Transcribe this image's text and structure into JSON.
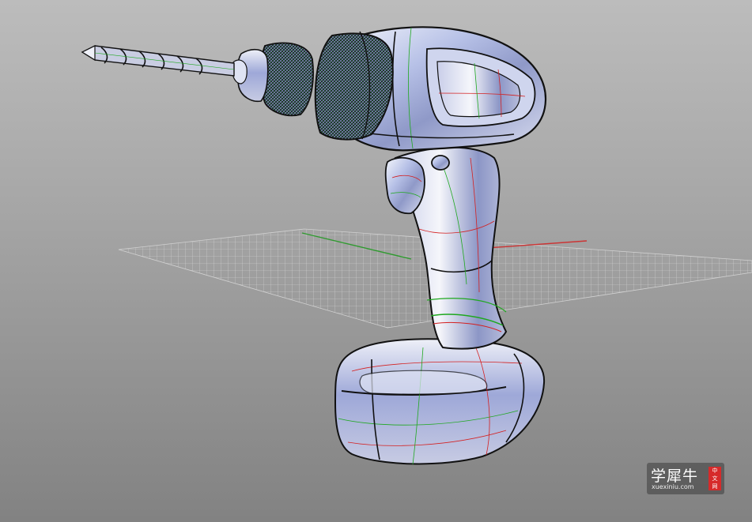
{
  "viewport": {
    "background_top": "#bcbcbc",
    "background_bottom": "#828282",
    "grid_color": "#d9d9d9",
    "x_axis_color": "#cc3333",
    "y_axis_color": "#2f9a2f"
  },
  "model": {
    "surface_color": "#a9b6e6",
    "isocurve_red": "#d42020",
    "isocurve_green": "#1fa81f",
    "edge_color": "#111111"
  },
  "watermark": {
    "logo_text": "学犀牛",
    "url": "xuexiniu.com",
    "badge_chars": [
      "中",
      "文",
      "网"
    ],
    "badge_color": "#d62a2a"
  }
}
